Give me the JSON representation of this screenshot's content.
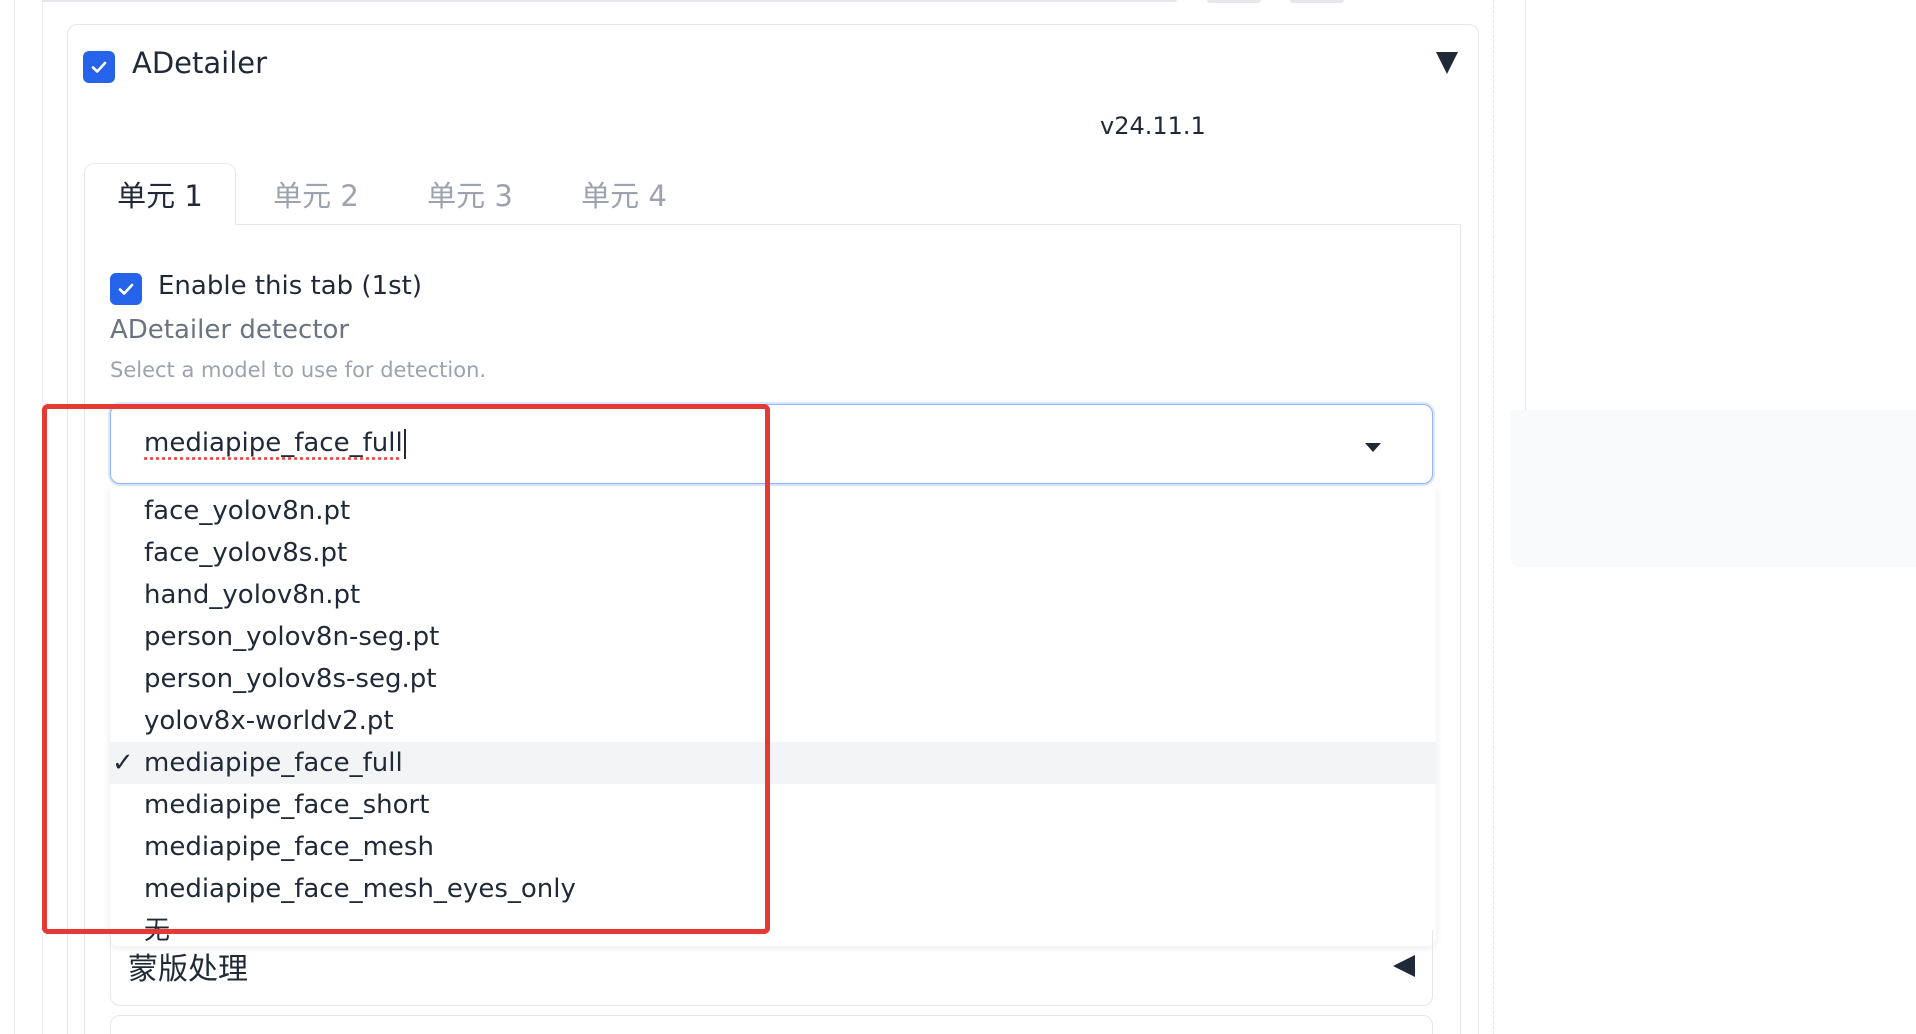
{
  "panel": {
    "title": "ADetailer",
    "enabled": true,
    "version": "v24.11.1"
  },
  "tabs": [
    {
      "label": "单元 1",
      "active": true
    },
    {
      "label": "单元 2",
      "active": false
    },
    {
      "label": "单元 3",
      "active": false
    },
    {
      "label": "单元 4",
      "active": false
    }
  ],
  "unit": {
    "enable_label": "Enable this tab (1st)",
    "enabled": true,
    "detector_label": "ADetailer detector",
    "detector_info": "Select a model to use for detection.",
    "detector_value": "mediapipe_face_full"
  },
  "options": [
    "face_yolov8n.pt",
    "face_yolov8s.pt",
    "hand_yolov8n.pt",
    "person_yolov8n-seg.pt",
    "person_yolov8s-seg.pt",
    "yolov8x-worldv2.pt",
    "mediapipe_face_full",
    "mediapipe_face_short",
    "mediapipe_face_mesh",
    "mediapipe_face_mesh_eyes_only",
    "无"
  ],
  "selected_option": "mediapipe_face_full",
  "selected_mark": "✓",
  "accordion": {
    "label": "蒙版处理",
    "collapsed": true
  },
  "colors": {
    "accent": "#2563eb",
    "annotation": "#e53935"
  }
}
